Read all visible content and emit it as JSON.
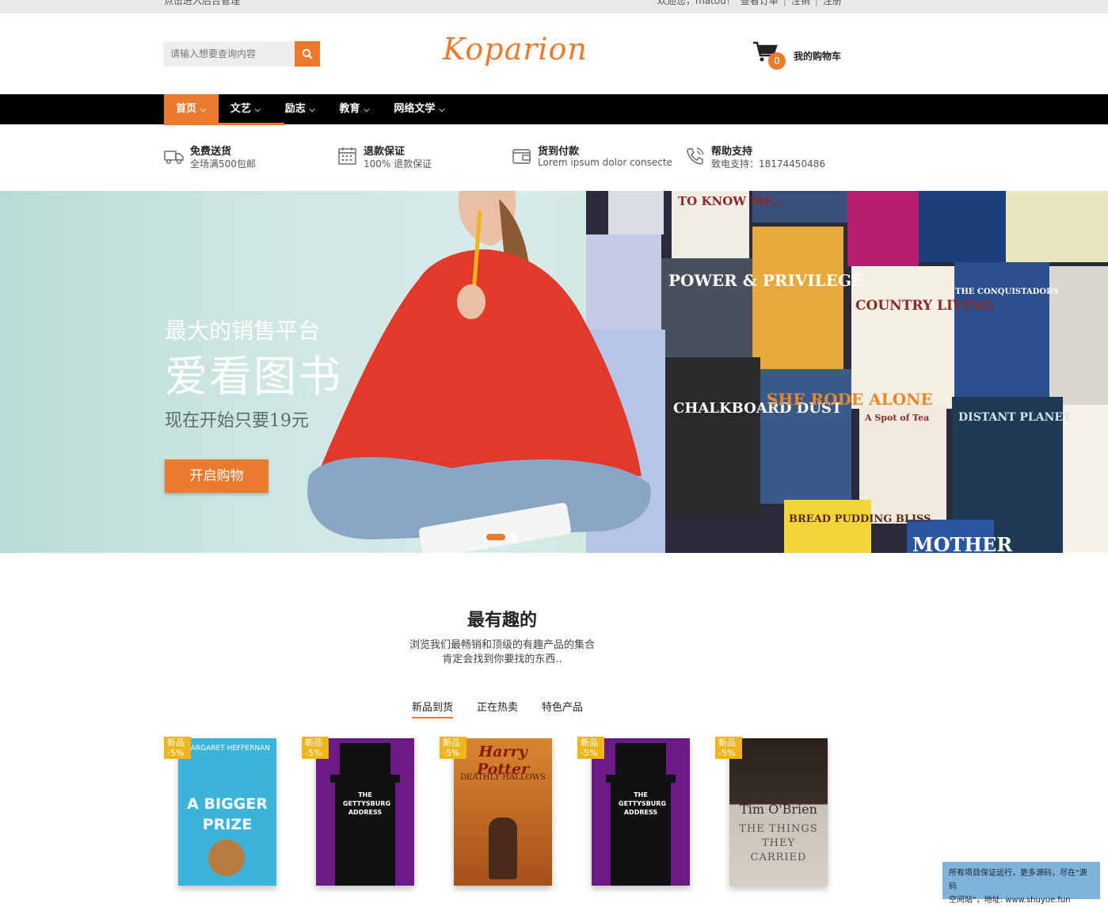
{
  "topbar": {
    "left_text": "点击进入后台管理",
    "welcome": "欢迎您，matou！",
    "links": [
      "查看订单",
      "注销",
      "注册"
    ],
    "separator": "|"
  },
  "search": {
    "placeholder": "请输入想要查询内容",
    "icon": "search-icon"
  },
  "logo": {
    "text": "Koparion"
  },
  "cart": {
    "count": "0",
    "label": "我的购物车",
    "icon": "cart-icon"
  },
  "nav": {
    "items": [
      {
        "label": "首页"
      },
      {
        "label": "文艺"
      },
      {
        "label": "励志"
      },
      {
        "label": "教育"
      },
      {
        "label": "网络文学"
      }
    ]
  },
  "services": [
    {
      "icon": "truck-icon",
      "title": "免费送货",
      "desc": "全场满500包邮"
    },
    {
      "icon": "calendar-icon",
      "title": "退款保证",
      "desc": "100% 退款保证"
    },
    {
      "icon": "wallet-icon",
      "title": "货到付款",
      "desc": "Lorem ipsum dolor consecte"
    },
    {
      "icon": "phone-icon",
      "title": "帮助支持",
      "desc": "致电支持：18174450486"
    }
  ],
  "hero": {
    "line1": "最大的销售平台",
    "line2": "爱看图书",
    "line3": "现在开始只要19元",
    "button": "开启购物",
    "book_titles": [
      "TO KNOW ME…",
      "POWER & PRIVILEGE",
      "COUNTRY LIVING",
      "THE CONQUISTADORS",
      "CHALKBOARD DUST",
      "SHE RODE ALONE",
      "A Spot of Tea",
      "DISTANT PLANET",
      "BREAD PUDDING BLISS",
      "MOTHER"
    ]
  },
  "section": {
    "title": "最有趣的",
    "subtitle1": "浏览我们最畅销和顶级的有趣产品的集合",
    "subtitle2": "肯定会找到你要找的东西..",
    "tabs": [
      "新品到货",
      "正在热卖",
      "特色产品"
    ]
  },
  "products": [
    {
      "badge": "新品",
      "discount": "-5%",
      "title": "A BIGGER PRIZE",
      "author": "MARGARET HEFFERNAN",
      "color": "#3cb4d9"
    },
    {
      "badge": "新品",
      "discount": "-5%",
      "title": "THE GETTYSBURG ADDRESS",
      "author": "",
      "color": "#6b1a86"
    },
    {
      "badge": "新品",
      "discount": "-5%",
      "title": "Harry Potter",
      "author": "DEATHLY HALLOWS",
      "color": "#c86a22"
    },
    {
      "badge": "新品",
      "discount": "-5%",
      "title": "THE GETTYSBURG ADDRESS",
      "author": "",
      "color": "#6b1a86"
    },
    {
      "badge": "新品",
      "discount": "-5%",
      "title": "Tim O'Brien",
      "author": "THE THINGS THEY CARRIED",
      "color": "#3a2e27"
    }
  ],
  "watermark": {
    "line1": "所有项目保证运行，更多源码，尽在\"源码",
    "line2": "空间站\"，地址: www.shuyue.fun"
  },
  "colors": {
    "accent": "#ec7a2c",
    "nav_bg": "#000000",
    "badge": "#f1b51c"
  }
}
